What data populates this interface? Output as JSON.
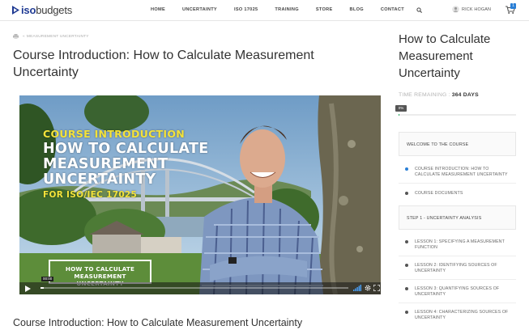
{
  "header": {
    "brand_iso": "iso",
    "brand_budgets": "budgets",
    "nav": [
      "HOME",
      "UNCERTAINTY",
      "ISO 17025",
      "TRAINING",
      "STORE",
      "BLOG",
      "CONTACT"
    ],
    "user_name": "RICK HOGAN",
    "cart_count": "1",
    "colors": {
      "brand_blue": "#1f3a93",
      "badge": "#2a7fd6"
    }
  },
  "breadcrumb": {
    "back_label": "«",
    "course_label": "MEASUREMENT UNCERTAINTY"
  },
  "main": {
    "title": "Course Introduction: How to Calculate Measurement Uncertainty",
    "lesson_heading": "Course Introduction: How to Calculate Measurement Uncertainty"
  },
  "video": {
    "kicker": "COURSE INTRODUCTION",
    "line1": "HOW TO CALCULATE",
    "line2": "MEASUREMENT",
    "line3": "UNCERTAINTY",
    "subtitle": "FOR ISO/IEC 17025",
    "box_line1": "HOW TO CALCULATE",
    "box_line2": "MEASUREMENT UNCERTAINTY",
    "time": "00:00",
    "progress_percent": 1
  },
  "sidebar": {
    "title": "How to Calculate Measurement Uncertainty",
    "time_label": "TIME REMAINING :",
    "time_value": "364 DAYS",
    "progress_label": "0%",
    "progress_percent": 0,
    "sections": [
      {
        "title": "WELCOME TO THE COURSE",
        "lessons": [
          "COURSE INTRODUCTION: HOW TO CALCULATE MEASUREMENT UNCERTAINTY",
          "COURSE DOCUMENTS"
        ]
      },
      {
        "title": "STEP 1 - UNCERTAINTY ANALYSIS",
        "lessons": [
          "LESSON 1: SPECIFYING A MEASUREMENT FUNCTION",
          "LESSON 2: IDENTIFYING SOURCES OF UNCERTAINTY",
          "LESSON 3: QUANTIFYING SOURCES OF UNCERTAINTY",
          "LESSON 4: CHARACTERIZING SOURCES OF UNCERTAINTY"
        ]
      }
    ]
  }
}
